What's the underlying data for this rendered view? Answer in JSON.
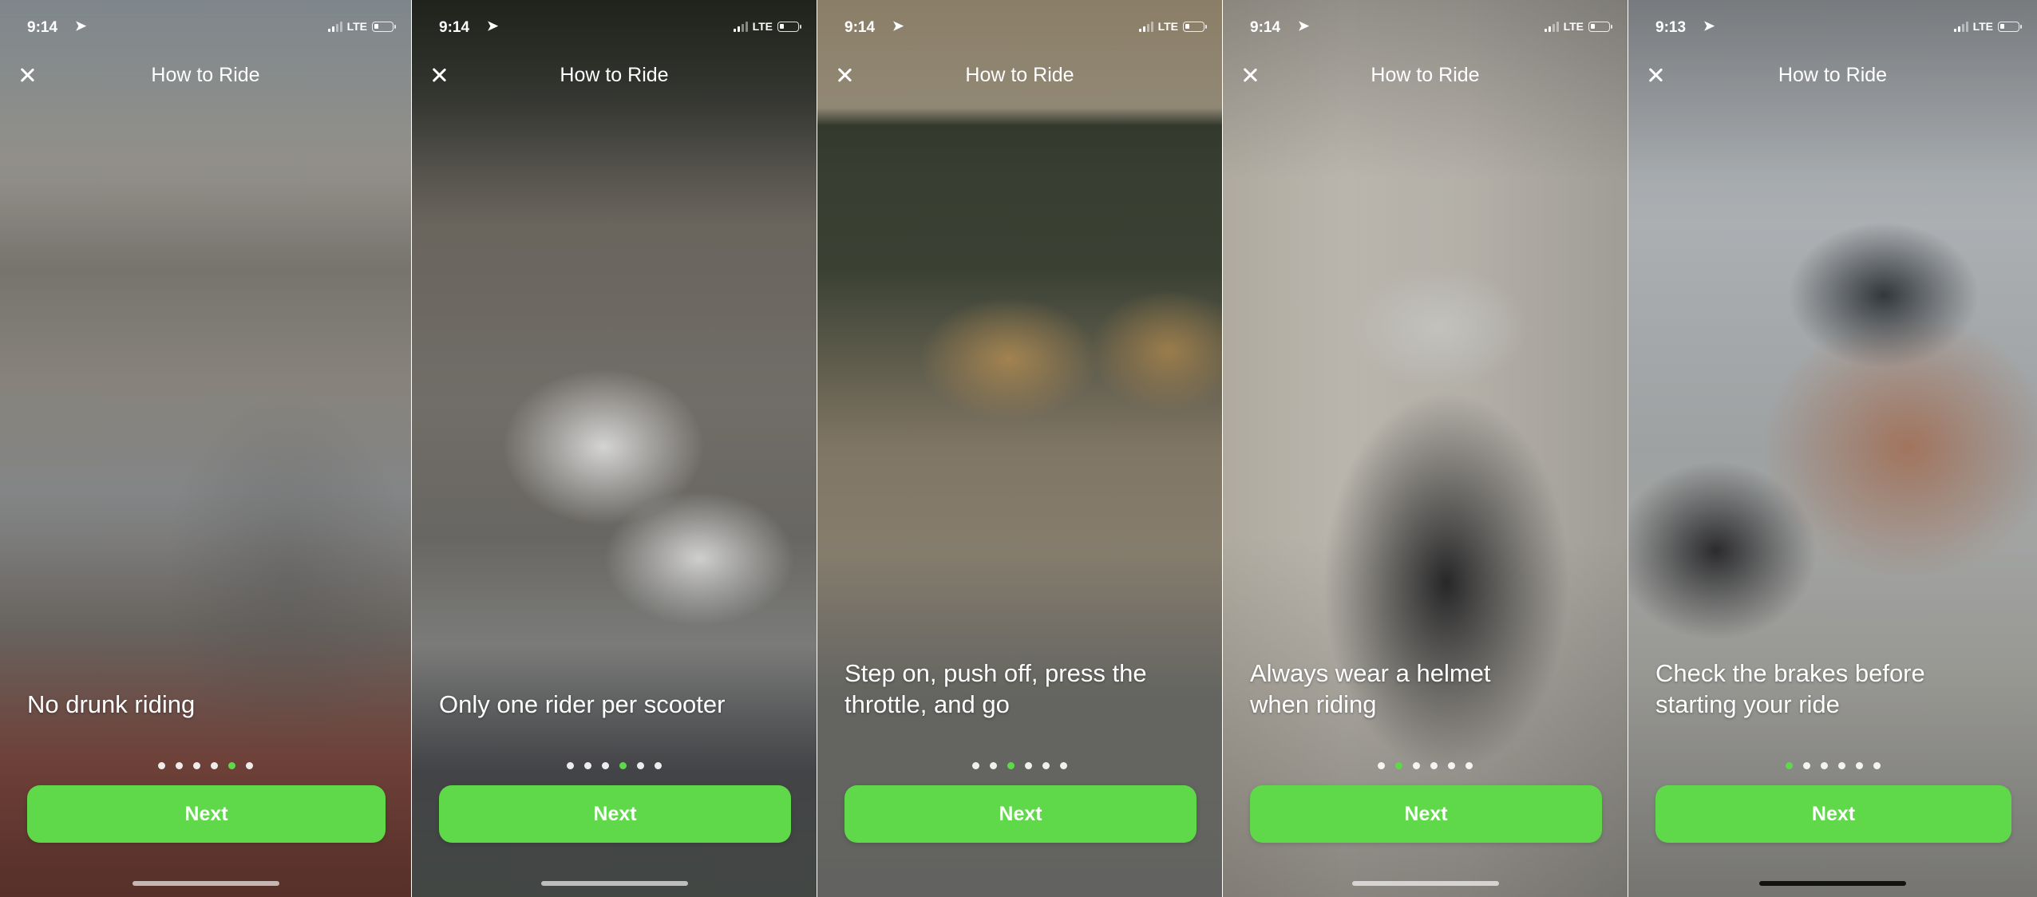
{
  "colors": {
    "accent": "#5fd84a",
    "text": "#ffffff"
  },
  "screens": [
    {
      "status": {
        "time": "9:14",
        "location_icon": "location-arrow-icon",
        "network": "LTE"
      },
      "title": "How to Ride",
      "caption": "No drunk riding",
      "page_count": 6,
      "active_page": 5,
      "next_label": "Next"
    },
    {
      "status": {
        "time": "9:14",
        "location_icon": "location-arrow-icon",
        "network": "LTE"
      },
      "title": "How to Ride",
      "caption": "Only one rider per scooter",
      "page_count": 6,
      "active_page": 4,
      "next_label": "Next"
    },
    {
      "status": {
        "time": "9:14",
        "location_icon": "location-arrow-icon",
        "network": "LTE"
      },
      "title": "How to Ride",
      "caption": "Step on, push off, press the\nthrottle, and go",
      "page_count": 6,
      "active_page": 3,
      "next_label": "Next"
    },
    {
      "status": {
        "time": "9:14",
        "location_icon": "location-arrow-icon",
        "network": "LTE"
      },
      "title": "How to Ride",
      "caption": "Always wear a helmet\nwhen riding",
      "page_count": 6,
      "active_page": 2,
      "next_label": "Next"
    },
    {
      "status": {
        "time": "9:13",
        "location_icon": "location-arrow-icon",
        "network": "LTE"
      },
      "title": "How to Ride",
      "caption": "Check the brakes before\nstarting your ride",
      "page_count": 6,
      "active_page": 1,
      "next_label": "Next"
    }
  ]
}
